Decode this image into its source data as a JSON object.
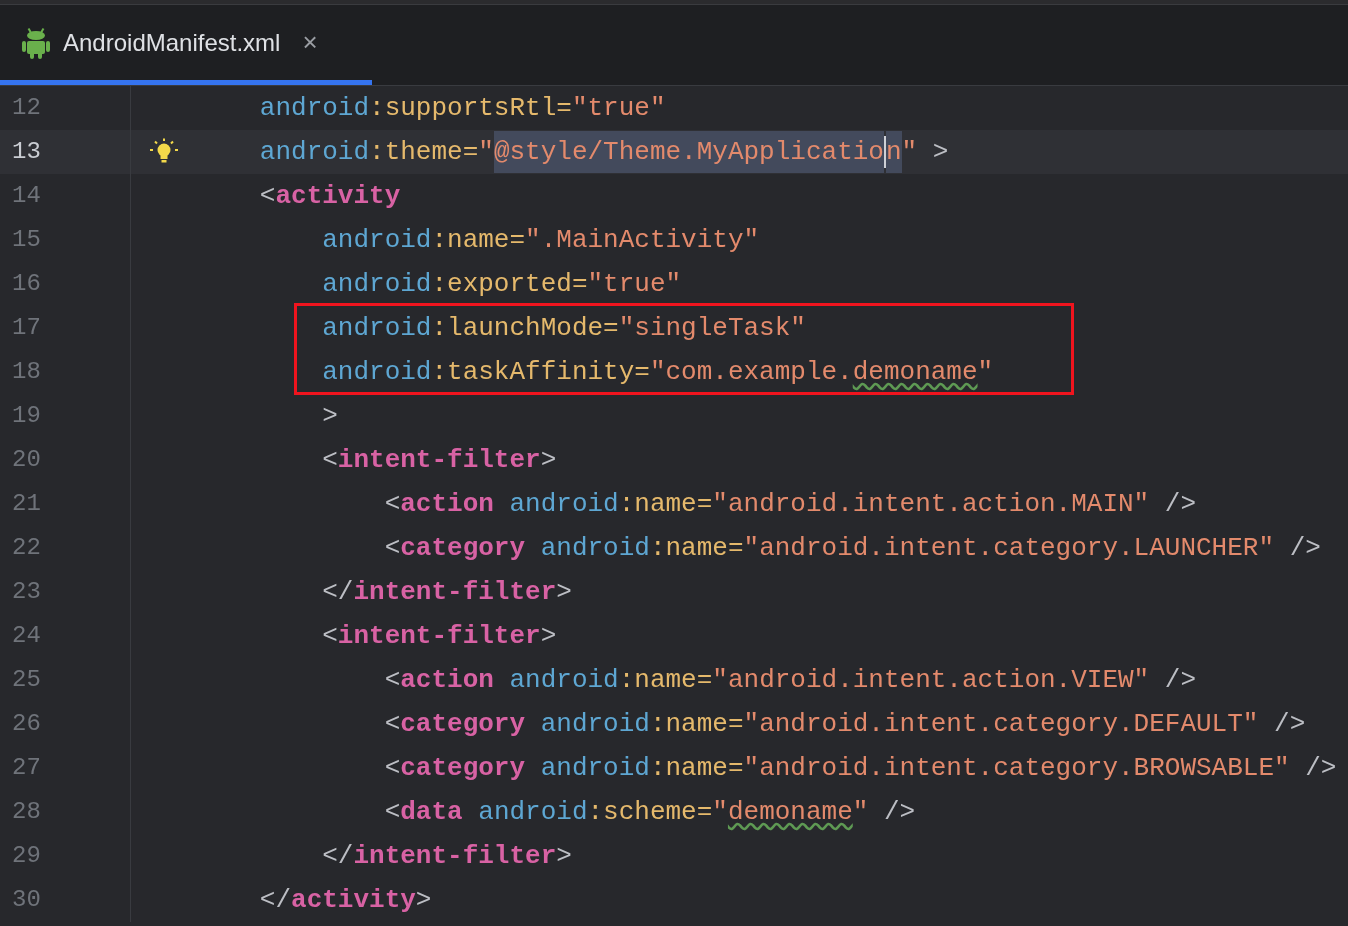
{
  "tab": {
    "title": "AndroidManifest.xml",
    "close": "×",
    "selected": true
  },
  "lines": [
    {
      "number": "12",
      "current": false,
      "tokens": [
        {
          "kind": "ns",
          "text": "        android"
        },
        {
          "kind": "attr",
          "text": ":supportsRtl="
        },
        {
          "kind": "str",
          "text": "\"true\""
        }
      ]
    },
    {
      "number": "13",
      "current": true,
      "bulb": true,
      "tokens": [
        {
          "kind": "ns",
          "text": "        android"
        },
        {
          "kind": "attr",
          "text": ":theme="
        },
        {
          "kind": "str",
          "text": "\""
        },
        {
          "kind": "selection",
          "text": "@style/Theme.MyApplicatio"
        },
        {
          "kind": "caret"
        },
        {
          "kind": "selection",
          "text": "n"
        },
        {
          "kind": "str",
          "text": "\""
        },
        {
          "kind": "punct",
          "text": " >"
        }
      ]
    },
    {
      "number": "14",
      "current": false,
      "tokens": [
        {
          "kind": "punct",
          "text": "        <"
        },
        {
          "kind": "tag",
          "text": "activity"
        }
      ]
    },
    {
      "number": "15",
      "current": false,
      "tokens": [
        {
          "kind": "ns",
          "text": "            android"
        },
        {
          "kind": "attr",
          "text": ":name="
        },
        {
          "kind": "str",
          "text": "\".MainActivity\""
        }
      ]
    },
    {
      "number": "16",
      "current": false,
      "tokens": [
        {
          "kind": "ns",
          "text": "            android"
        },
        {
          "kind": "attr",
          "text": ":exported="
        },
        {
          "kind": "str",
          "text": "\"true\""
        }
      ]
    },
    {
      "number": "17",
      "current": false,
      "boxed": true,
      "tokens": [
        {
          "kind": "ns",
          "text": "            android"
        },
        {
          "kind": "attr",
          "text": ":launchMode="
        },
        {
          "kind": "str",
          "text": "\"singleTask\""
        }
      ]
    },
    {
      "number": "18",
      "current": false,
      "boxed": true,
      "tokens": [
        {
          "kind": "ns",
          "text": "            android"
        },
        {
          "kind": "attr",
          "text": ":taskAffinity="
        },
        {
          "kind": "str",
          "text": "\"com.example."
        },
        {
          "kind": "typo",
          "text": "demoname"
        },
        {
          "kind": "str",
          "text": "\""
        }
      ]
    },
    {
      "number": "19",
      "current": false,
      "tokens": [
        {
          "kind": "punct",
          "text": "            >"
        }
      ]
    },
    {
      "number": "20",
      "current": false,
      "tokens": [
        {
          "kind": "punct",
          "text": "            <"
        },
        {
          "kind": "tag",
          "text": "intent-filter"
        },
        {
          "kind": "punct",
          "text": ">"
        }
      ]
    },
    {
      "number": "21",
      "current": false,
      "tokens": [
        {
          "kind": "punct",
          "text": "                <"
        },
        {
          "kind": "tag",
          "text": "action"
        },
        {
          "kind": "ns",
          "text": " android"
        },
        {
          "kind": "attr",
          "text": ":name="
        },
        {
          "kind": "str",
          "text": "\"android.intent.action.MAIN\""
        },
        {
          "kind": "punct",
          "text": " />"
        }
      ]
    },
    {
      "number": "22",
      "current": false,
      "tokens": [
        {
          "kind": "punct",
          "text": "                <"
        },
        {
          "kind": "tag",
          "text": "category"
        },
        {
          "kind": "ns",
          "text": " android"
        },
        {
          "kind": "attr",
          "text": ":name="
        },
        {
          "kind": "str",
          "text": "\"android.intent.category.LAUNCHER\""
        },
        {
          "kind": "punct",
          "text": " />"
        }
      ]
    },
    {
      "number": "23",
      "current": false,
      "tokens": [
        {
          "kind": "punct",
          "text": "            </"
        },
        {
          "kind": "tag",
          "text": "intent-filter"
        },
        {
          "kind": "punct",
          "text": ">"
        }
      ]
    },
    {
      "number": "24",
      "current": false,
      "tokens": [
        {
          "kind": "punct",
          "text": "            <"
        },
        {
          "kind": "tag",
          "text": "intent-filter"
        },
        {
          "kind": "punct",
          "text": ">"
        }
      ]
    },
    {
      "number": "25",
      "current": false,
      "tokens": [
        {
          "kind": "punct",
          "text": "                <"
        },
        {
          "kind": "tag",
          "text": "action"
        },
        {
          "kind": "ns",
          "text": " android"
        },
        {
          "kind": "attr",
          "text": ":name="
        },
        {
          "kind": "str",
          "text": "\"android.intent.action.VIEW\""
        },
        {
          "kind": "punct",
          "text": " />"
        }
      ]
    },
    {
      "number": "26",
      "current": false,
      "tokens": [
        {
          "kind": "punct",
          "text": "                <"
        },
        {
          "kind": "tag",
          "text": "category"
        },
        {
          "kind": "ns",
          "text": " android"
        },
        {
          "kind": "attr",
          "text": ":name="
        },
        {
          "kind": "str",
          "text": "\"android.intent.category.DEFAULT\""
        },
        {
          "kind": "punct",
          "text": " />"
        }
      ]
    },
    {
      "number": "27",
      "current": false,
      "tokens": [
        {
          "kind": "punct",
          "text": "                <"
        },
        {
          "kind": "tag",
          "text": "category"
        },
        {
          "kind": "ns",
          "text": " android"
        },
        {
          "kind": "attr",
          "text": ":name="
        },
        {
          "kind": "str",
          "text": "\"android.intent.category.BROWSABLE\""
        },
        {
          "kind": "punct",
          "text": " />"
        }
      ]
    },
    {
      "number": "28",
      "current": false,
      "tokens": [
        {
          "kind": "punct",
          "text": "                <"
        },
        {
          "kind": "tag",
          "text": "data"
        },
        {
          "kind": "ns",
          "text": " android"
        },
        {
          "kind": "attr",
          "text": ":scheme="
        },
        {
          "kind": "str",
          "text": "\""
        },
        {
          "kind": "typo",
          "text": "demoname"
        },
        {
          "kind": "str",
          "text": "\""
        },
        {
          "kind": "punct",
          "text": " />"
        }
      ]
    },
    {
      "number": "29",
      "current": false,
      "tokens": [
        {
          "kind": "punct",
          "text": "            </"
        },
        {
          "kind": "tag",
          "text": "intent-filter"
        },
        {
          "kind": "punct",
          "text": ">"
        }
      ]
    },
    {
      "number": "30",
      "current": false,
      "tokens": [
        {
          "kind": "punct",
          "text": "        </"
        },
        {
          "kind": "tag",
          "text": "activity"
        },
        {
          "kind": "punct",
          "text": ">"
        }
      ]
    }
  ]
}
